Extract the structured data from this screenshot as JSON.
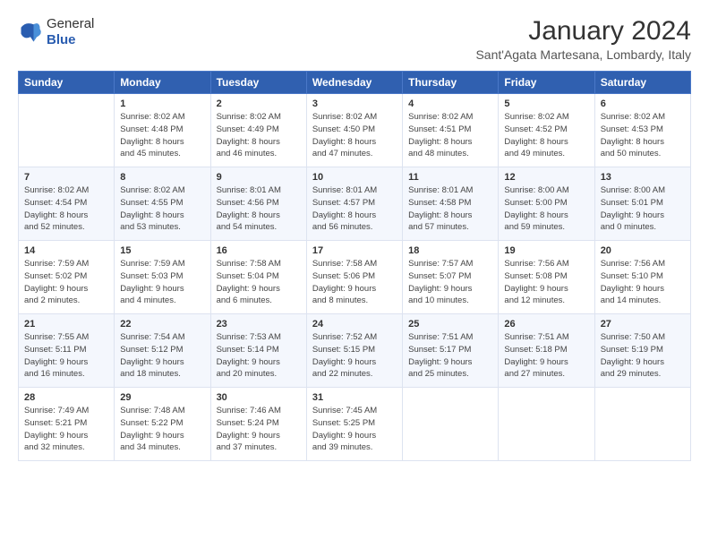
{
  "logo": {
    "general": "General",
    "blue": "Blue"
  },
  "title": "January 2024",
  "subtitle": "Sant'Agata Martesana, Lombardy, Italy",
  "headers": [
    "Sunday",
    "Monday",
    "Tuesday",
    "Wednesday",
    "Thursday",
    "Friday",
    "Saturday"
  ],
  "weeks": [
    [
      {
        "day": "",
        "info": ""
      },
      {
        "day": "1",
        "info": "Sunrise: 8:02 AM\nSunset: 4:48 PM\nDaylight: 8 hours\nand 45 minutes."
      },
      {
        "day": "2",
        "info": "Sunrise: 8:02 AM\nSunset: 4:49 PM\nDaylight: 8 hours\nand 46 minutes."
      },
      {
        "day": "3",
        "info": "Sunrise: 8:02 AM\nSunset: 4:50 PM\nDaylight: 8 hours\nand 47 minutes."
      },
      {
        "day": "4",
        "info": "Sunrise: 8:02 AM\nSunset: 4:51 PM\nDaylight: 8 hours\nand 48 minutes."
      },
      {
        "day": "5",
        "info": "Sunrise: 8:02 AM\nSunset: 4:52 PM\nDaylight: 8 hours\nand 49 minutes."
      },
      {
        "day": "6",
        "info": "Sunrise: 8:02 AM\nSunset: 4:53 PM\nDaylight: 8 hours\nand 50 minutes."
      }
    ],
    [
      {
        "day": "7",
        "info": "Sunrise: 8:02 AM\nSunset: 4:54 PM\nDaylight: 8 hours\nand 52 minutes."
      },
      {
        "day": "8",
        "info": "Sunrise: 8:02 AM\nSunset: 4:55 PM\nDaylight: 8 hours\nand 53 minutes."
      },
      {
        "day": "9",
        "info": "Sunrise: 8:01 AM\nSunset: 4:56 PM\nDaylight: 8 hours\nand 54 minutes."
      },
      {
        "day": "10",
        "info": "Sunrise: 8:01 AM\nSunset: 4:57 PM\nDaylight: 8 hours\nand 56 minutes."
      },
      {
        "day": "11",
        "info": "Sunrise: 8:01 AM\nSunset: 4:58 PM\nDaylight: 8 hours\nand 57 minutes."
      },
      {
        "day": "12",
        "info": "Sunrise: 8:00 AM\nSunset: 5:00 PM\nDaylight: 8 hours\nand 59 minutes."
      },
      {
        "day": "13",
        "info": "Sunrise: 8:00 AM\nSunset: 5:01 PM\nDaylight: 9 hours\nand 0 minutes."
      }
    ],
    [
      {
        "day": "14",
        "info": "Sunrise: 7:59 AM\nSunset: 5:02 PM\nDaylight: 9 hours\nand 2 minutes."
      },
      {
        "day": "15",
        "info": "Sunrise: 7:59 AM\nSunset: 5:03 PM\nDaylight: 9 hours\nand 4 minutes."
      },
      {
        "day": "16",
        "info": "Sunrise: 7:58 AM\nSunset: 5:04 PM\nDaylight: 9 hours\nand 6 minutes."
      },
      {
        "day": "17",
        "info": "Sunrise: 7:58 AM\nSunset: 5:06 PM\nDaylight: 9 hours\nand 8 minutes."
      },
      {
        "day": "18",
        "info": "Sunrise: 7:57 AM\nSunset: 5:07 PM\nDaylight: 9 hours\nand 10 minutes."
      },
      {
        "day": "19",
        "info": "Sunrise: 7:56 AM\nSunset: 5:08 PM\nDaylight: 9 hours\nand 12 minutes."
      },
      {
        "day": "20",
        "info": "Sunrise: 7:56 AM\nSunset: 5:10 PM\nDaylight: 9 hours\nand 14 minutes."
      }
    ],
    [
      {
        "day": "21",
        "info": "Sunrise: 7:55 AM\nSunset: 5:11 PM\nDaylight: 9 hours\nand 16 minutes."
      },
      {
        "day": "22",
        "info": "Sunrise: 7:54 AM\nSunset: 5:12 PM\nDaylight: 9 hours\nand 18 minutes."
      },
      {
        "day": "23",
        "info": "Sunrise: 7:53 AM\nSunset: 5:14 PM\nDaylight: 9 hours\nand 20 minutes."
      },
      {
        "day": "24",
        "info": "Sunrise: 7:52 AM\nSunset: 5:15 PM\nDaylight: 9 hours\nand 22 minutes."
      },
      {
        "day": "25",
        "info": "Sunrise: 7:51 AM\nSunset: 5:17 PM\nDaylight: 9 hours\nand 25 minutes."
      },
      {
        "day": "26",
        "info": "Sunrise: 7:51 AM\nSunset: 5:18 PM\nDaylight: 9 hours\nand 27 minutes."
      },
      {
        "day": "27",
        "info": "Sunrise: 7:50 AM\nSunset: 5:19 PM\nDaylight: 9 hours\nand 29 minutes."
      }
    ],
    [
      {
        "day": "28",
        "info": "Sunrise: 7:49 AM\nSunset: 5:21 PM\nDaylight: 9 hours\nand 32 minutes."
      },
      {
        "day": "29",
        "info": "Sunrise: 7:48 AM\nSunset: 5:22 PM\nDaylight: 9 hours\nand 34 minutes."
      },
      {
        "day": "30",
        "info": "Sunrise: 7:46 AM\nSunset: 5:24 PM\nDaylight: 9 hours\nand 37 minutes."
      },
      {
        "day": "31",
        "info": "Sunrise: 7:45 AM\nSunset: 5:25 PM\nDaylight: 9 hours\nand 39 minutes."
      },
      {
        "day": "",
        "info": ""
      },
      {
        "day": "",
        "info": ""
      },
      {
        "day": "",
        "info": ""
      }
    ]
  ]
}
